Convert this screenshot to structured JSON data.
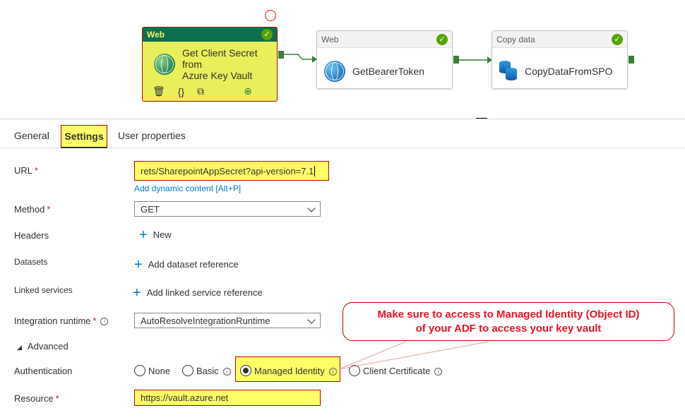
{
  "pipeline": {
    "activities": [
      {
        "type": "Web",
        "name": "Get Client Secret from Azure Key Vault",
        "name_line1": "Get Client Secret from",
        "name_line2": "Azure Key Vault"
      },
      {
        "type": "Web",
        "name": "GetBearerToken"
      },
      {
        "type": "Copy data",
        "name": "CopyDataFromSPO"
      }
    ],
    "toolbar_icons": [
      "delete-icon",
      "code-icon",
      "copy-icon",
      "add-output-icon"
    ]
  },
  "tabs": [
    {
      "label": "General"
    },
    {
      "label": "Settings",
      "selected": true
    },
    {
      "label": "User properties"
    }
  ],
  "form": {
    "url": {
      "label": "URL",
      "required": "*",
      "value": "rets/SharepointAppSecret?api-version=7.1",
      "dynamic_link": "Add dynamic content [Alt+P]"
    },
    "method": {
      "label": "Method",
      "required": "*",
      "value": "GET"
    },
    "headers": {
      "label": "Headers",
      "action": "New"
    },
    "datasets": {
      "label": "Datasets",
      "action": "Add dataset reference"
    },
    "linked_services": {
      "label": "Linked services",
      "action": "Add linked service reference"
    },
    "integration_runtime": {
      "label": "Integration runtime",
      "required": "*",
      "value": "AutoResolveIntegrationRuntime"
    },
    "advanced": {
      "label": "Advanced"
    },
    "authentication": {
      "label": "Authentication",
      "options": [
        "None",
        "Basic",
        "Managed Identity",
        "Client Certificate"
      ],
      "selected": "Managed Identity"
    },
    "resource": {
      "label": "Resource",
      "required": "*",
      "value": "https://vault.azure.net"
    }
  },
  "callout": {
    "line1": "Make sure to access to Managed Identity (Object ID)",
    "line2": "of your ADF to access your key vault"
  },
  "colors": {
    "highlight": "#ffff66",
    "annotation": "#c00000",
    "success": "#57a300",
    "link": "#0078d4"
  }
}
